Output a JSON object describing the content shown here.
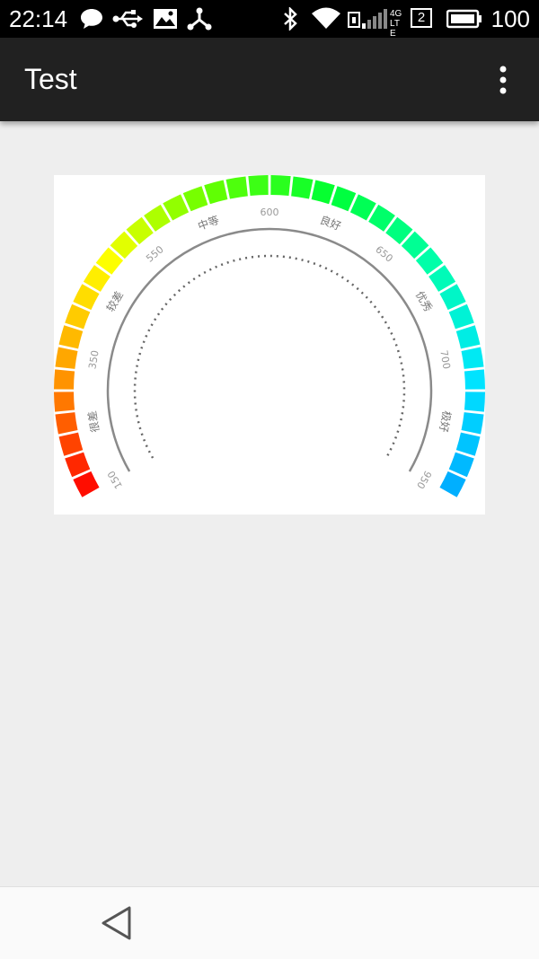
{
  "status_bar": {
    "time": "22:14",
    "battery_level": "100",
    "network_type": "4G LTE",
    "sim_slot": "2",
    "icons": [
      "chat-icon",
      "usb-icon",
      "image-icon",
      "share-icon",
      "bluetooth-icon",
      "wifi-icon",
      "sim-icon",
      "signal-icon",
      "sim-slot-icon",
      "battery-icon"
    ]
  },
  "app_bar": {
    "title": "Test",
    "overflow_icon": "more-vert-icon"
  },
  "gauge": {
    "ticks": [
      "150",
      "350",
      "550",
      "600",
      "650",
      "700",
      "950"
    ],
    "grades": [
      "很差",
      "较差",
      "中等",
      "良好",
      "优秀",
      "极好"
    ],
    "gradient_colors": [
      "#ff0000",
      "#ff9900",
      "#ffff00",
      "#66ff00",
      "#00ff33",
      "#00ffaa",
      "#00e5ff",
      "#00aaff"
    ]
  },
  "nav_bar": {
    "back_icon": "back-triangle-icon"
  }
}
